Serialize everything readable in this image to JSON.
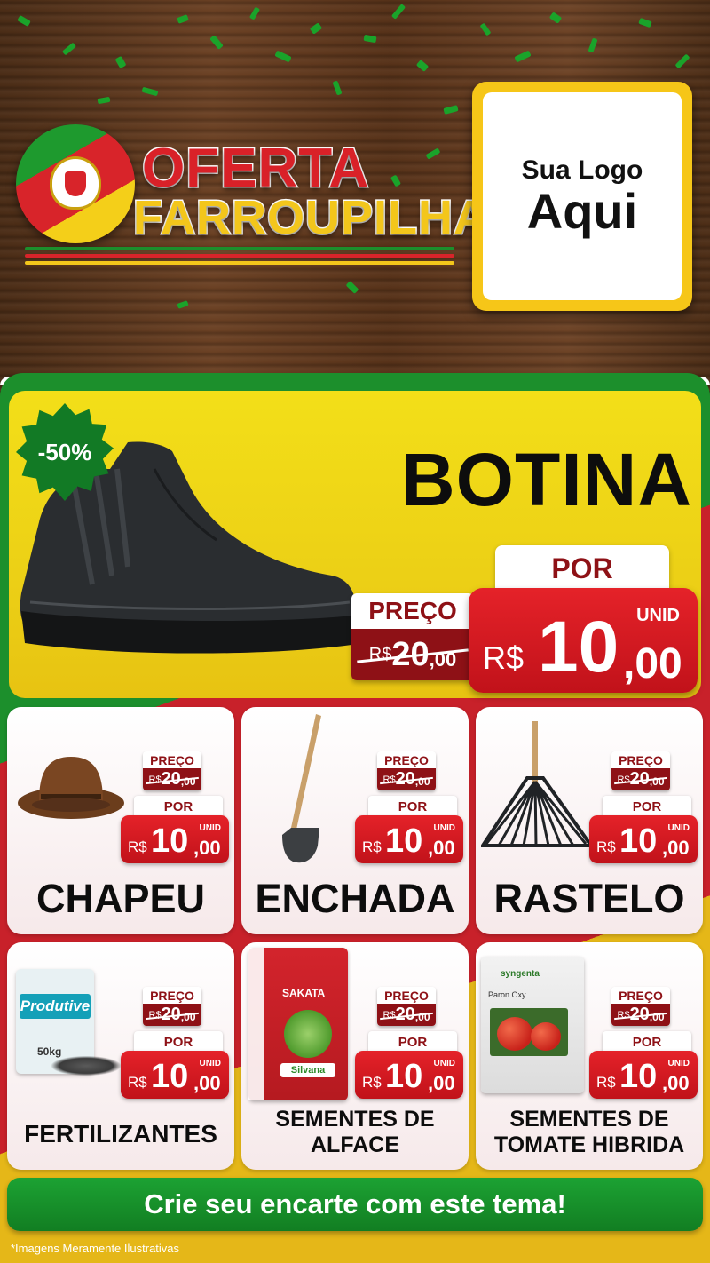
{
  "header": {
    "title_line1": "OFERTA",
    "title_line2": "FARROUPILHA",
    "logo_line1": "Sua Logo",
    "logo_line2": "Aqui"
  },
  "colors": {
    "green": "#1c8f2c",
    "red": "#c8212a",
    "yellow": "#e5b718",
    "price_red": "#e52229",
    "dark_red": "#8e1116"
  },
  "hero": {
    "discount_badge": "-50%",
    "name": "BOTINA",
    "por_label": "POR",
    "preco_label": "PREÇO",
    "old_currency": "R$",
    "old_int": "20",
    "old_cents": ",00",
    "unit_label": "UNID",
    "currency": "R$",
    "price_int": "10",
    "price_cents": ",00"
  },
  "products": [
    {
      "name": "CHAPEU",
      "preco_label": "PREÇO",
      "old_currency": "R$",
      "old_int": "20",
      "old_cents": ",00",
      "por_label": "POR",
      "unit_label": "UNID",
      "currency": "R$",
      "price_int": "10",
      "price_cents": ",00",
      "icon": "hat-icon"
    },
    {
      "name": "ENCHADA",
      "preco_label": "PREÇO",
      "old_currency": "R$",
      "old_int": "20",
      "old_cents": ",00",
      "por_label": "POR",
      "unit_label": "UNID",
      "currency": "R$",
      "price_int": "10",
      "price_cents": ",00",
      "icon": "hoe-icon"
    },
    {
      "name": "RASTELO",
      "preco_label": "PREÇO",
      "old_currency": "R$",
      "old_int": "20",
      "old_cents": ",00",
      "por_label": "POR",
      "unit_label": "UNID",
      "currency": "R$",
      "price_int": "10",
      "price_cents": ",00",
      "icon": "rake-icon"
    },
    {
      "name": "FERTILIZANTES",
      "preco_label": "PREÇO",
      "old_currency": "R$",
      "old_int": "20",
      "old_cents": ",00",
      "por_label": "POR",
      "unit_label": "UNID",
      "currency": "R$",
      "price_int": "10",
      "price_cents": ",00",
      "icon": "fertilizer-bag-icon",
      "pack_brand": "Produtive",
      "pack_weight": "50kg"
    },
    {
      "name_line1": "SEMENTES DE",
      "name_line2": "ALFACE",
      "preco_label": "PREÇO",
      "old_currency": "R$",
      "old_int": "20",
      "old_cents": ",00",
      "por_label": "POR",
      "unit_label": "UNID",
      "currency": "R$",
      "price_int": "10",
      "price_cents": ",00",
      "icon": "seed-pack-icon",
      "pack_brand": "SAKATA",
      "pack_sub": "Silvana"
    },
    {
      "name_line1": "SEMENTES DE",
      "name_line2": "TOMATE HIBRIDA",
      "preco_label": "PREÇO",
      "old_currency": "R$",
      "old_int": "20",
      "old_cents": ",00",
      "por_label": "POR",
      "unit_label": "UNID",
      "currency": "R$",
      "price_int": "10",
      "price_cents": ",00",
      "icon": "tomato-seed-pack-icon",
      "pack_brand": "syngenta",
      "pack_sub": "Paron Oxy"
    }
  ],
  "cta": {
    "label": "Crie seu encarte com este tema!"
  },
  "footer": {
    "disclaimer": "*Imagens Meramente Ilustrativas"
  }
}
